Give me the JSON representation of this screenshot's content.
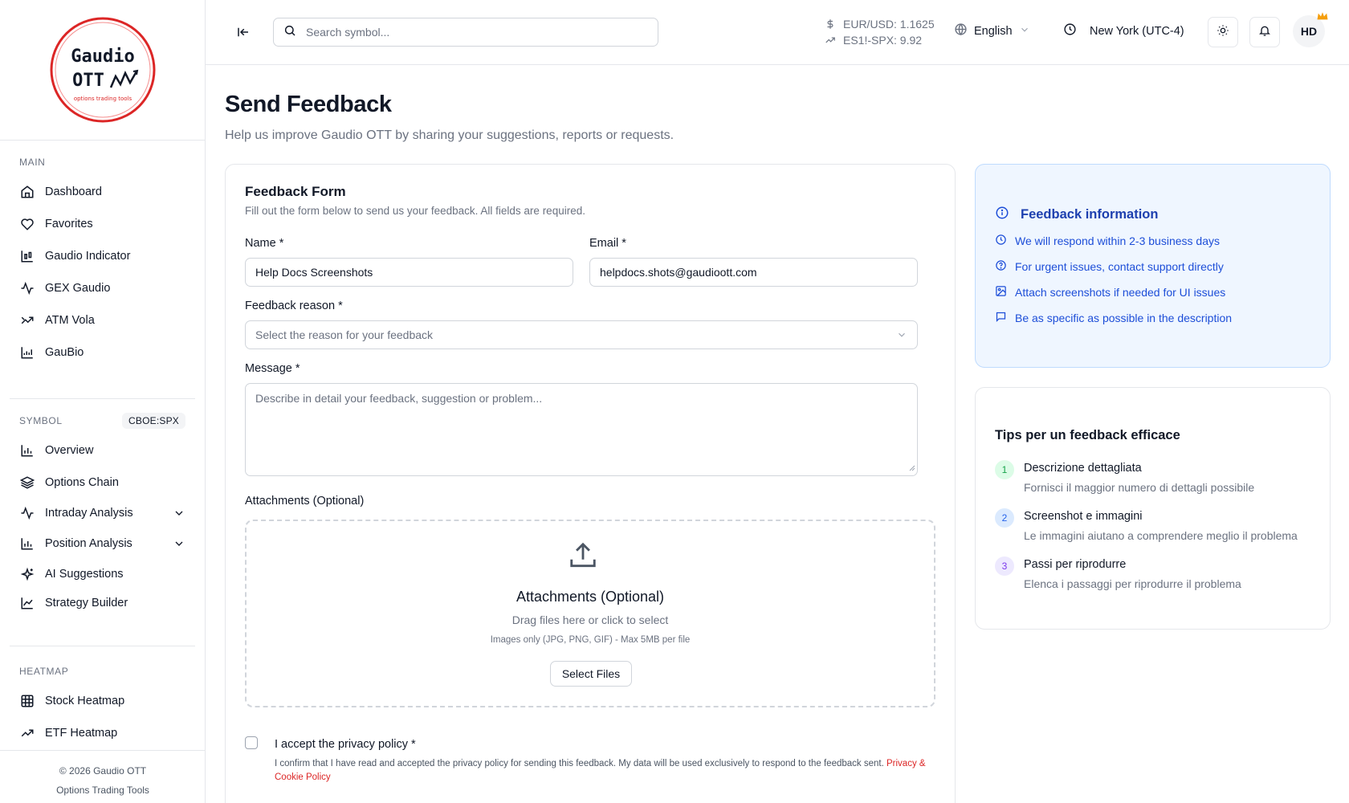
{
  "brand": {
    "logo_line1": "Gaudio",
    "logo_line2": "OTT",
    "logo_tag": "options trading tools"
  },
  "sidebar": {
    "main_title": "MAIN",
    "main_items": [
      {
        "label": "Dashboard",
        "icon": "home-icon"
      },
      {
        "label": "Favorites",
        "icon": "heart-icon"
      },
      {
        "label": "Gaudio Indicator",
        "icon": "chart-candle-icon"
      },
      {
        "label": "GEX Gaudio",
        "icon": "activity-icon"
      },
      {
        "label": "ATM Vola",
        "icon": "trend-icon"
      },
      {
        "label": "GauBio",
        "icon": "chart-area-icon"
      }
    ],
    "symbol_title": "SYMBOL",
    "symbol_badge": "CBOE:SPX",
    "symbol_items": [
      {
        "label": "Overview",
        "icon": "bar-chart-icon"
      },
      {
        "label": "Options Chain",
        "icon": "layers-icon"
      },
      {
        "label": "Intraday Analysis",
        "icon": "activity-icon"
      },
      {
        "label": "Position Analysis",
        "icon": "bar-chart-icon"
      },
      {
        "label": "AI Suggestions",
        "icon": "sparkles-icon"
      },
      {
        "label": "Strategy Builder",
        "icon": "line-chart-icon"
      }
    ],
    "heatmap_title": "HEATMAP",
    "heatmap_items": [
      {
        "label": "Stock Heatmap",
        "icon": "grid-icon"
      },
      {
        "label": "ETF Heatmap",
        "icon": "trending-up-icon"
      }
    ],
    "footer_copyright": "© 2026 Gaudio OTT",
    "footer_tagline": "Options Trading Tools"
  },
  "header": {
    "search_placeholder": "Search symbol...",
    "ticker1": "EUR/USD: 1.1625",
    "ticker2": "ES1!-SPX: 9.92",
    "language": "English",
    "timezone": "New York (UTC-4)",
    "avatar_initials": "HD"
  },
  "page": {
    "title": "Send Feedback",
    "subtitle": "Help us improve Gaudio OTT by sharing your suggestions, reports or requests."
  },
  "form": {
    "title": "Feedback Form",
    "description": "Fill out the form below to send us your feedback. All fields are required.",
    "name_label": "Name *",
    "name_value": "Help Docs Screenshots",
    "email_label": "Email *",
    "email_value": "helpdocs.shots@gaudioott.com",
    "reason_label": "Feedback reason *",
    "reason_placeholder": "Select the reason for your feedback",
    "message_label": "Message *",
    "message_placeholder": "Describe in detail your feedback, suggestion or problem...",
    "attachments_label": "Attachments (Optional)",
    "dropzone_title": "Attachments (Optional)",
    "dropzone_sub": "Drag files here or click to select",
    "dropzone_note": "Images only (JPG, PNG, GIF) - Max 5MB per file",
    "select_files": "Select Files",
    "privacy_label": "I accept the privacy policy *",
    "privacy_desc": "I confirm that I have read and accepted the privacy policy for sending this feedback. My data will be used exclusively to respond to the feedback sent.",
    "privacy_link": "Privacy & Cookie Policy",
    "privacy_checked": false
  },
  "info": {
    "title": "Feedback information",
    "items": [
      {
        "text": "We will respond within 2-3 business days",
        "icon": "clock-icon"
      },
      {
        "text": "For urgent issues, contact support directly",
        "icon": "help-circle-icon"
      },
      {
        "text": "Attach screenshots if needed for UI issues",
        "icon": "image-icon"
      },
      {
        "text": "Be as specific as possible in the description",
        "icon": "message-square-icon"
      }
    ]
  },
  "tips": {
    "title": "Tips per un feedback efficace",
    "items": [
      {
        "num": "1",
        "title": "Descrizione dettagliata",
        "desc": "Fornisci il maggior numero di dettagli possibile",
        "color": "#16a34a",
        "bg": "#dcfce7"
      },
      {
        "num": "2",
        "title": "Screenshot e immagini",
        "desc": "Le immagini aiutano a comprendere meglio il problema",
        "color": "#2563eb",
        "bg": "#dbeafe"
      },
      {
        "num": "3",
        "title": "Passi per riprodurre",
        "desc": "Elenca i passaggi per riprodurre il problema",
        "color": "#7c3aed",
        "bg": "#ede9fe"
      }
    ]
  },
  "colors": {
    "accent_red": "#dc2626",
    "info_blue": "#1d4ed8",
    "info_bg": "#eff6ff",
    "crown": "#f59e0b"
  }
}
